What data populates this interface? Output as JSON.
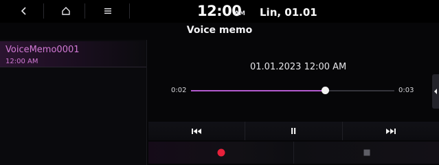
{
  "status_bar": {
    "clock": "12:00",
    "clock_ampm": "AM",
    "date": "Lin, 01.01",
    "icons": [
      "back-icon",
      "home-icon",
      "menu-icon"
    ]
  },
  "title": "Voice memo",
  "memo_list": [
    {
      "name": "VoiceMemo0001",
      "time": "12:00 AM"
    }
  ],
  "player": {
    "recorded_at": "01.01.2023 12:00 AM",
    "elapsed": "0:02",
    "duration": "0:03",
    "progress_fraction": 0.66
  },
  "controls": {
    "transport_icons": [
      "previous-icon",
      "pause-icon",
      "next-icon"
    ],
    "record_icons": [
      "record-icon",
      "stop-icon"
    ]
  },
  "colors": {
    "accent": "#b45bd0",
    "list_text": "#d37ad6",
    "record_red": "#e8213b",
    "stop_gray": "#5e5e66"
  }
}
